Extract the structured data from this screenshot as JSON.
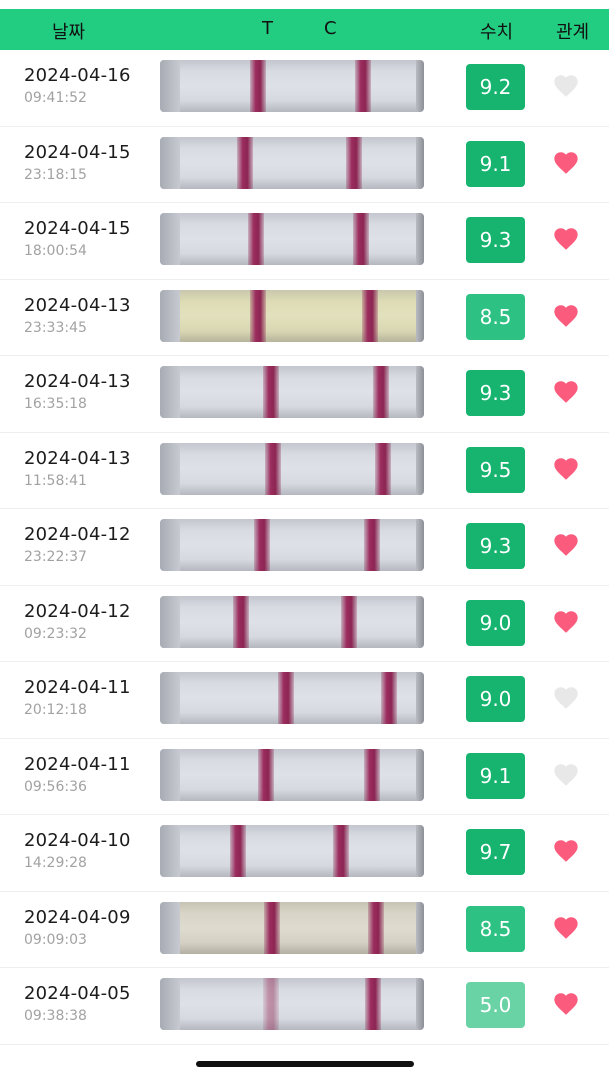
{
  "header": {
    "date_label": "날짜",
    "t_label": "T",
    "c_label": "C",
    "value_label": "수치",
    "relation_label": "관계"
  },
  "colors": {
    "header_bg": "#22cd82",
    "badge_strong": "#16b46f",
    "badge_mid": "#2dc283",
    "badge_light": "#6ad3a5",
    "heart_on": "#fb5b7d",
    "heart_off": "#e8e8e8"
  },
  "rows": [
    {
      "date": "2024-04-16",
      "time": "09:41:52",
      "value": "9.2",
      "heart": false,
      "tone": "strong",
      "strip_bg": "cool"
    },
    {
      "date": "2024-04-15",
      "time": "23:18:15",
      "value": "9.1",
      "heart": true,
      "tone": "strong",
      "strip_bg": "cool"
    },
    {
      "date": "2024-04-15",
      "time": "18:00:54",
      "value": "9.3",
      "heart": true,
      "tone": "strong",
      "strip_bg": "cool"
    },
    {
      "date": "2024-04-13",
      "time": "23:33:45",
      "value": "8.5",
      "heart": true,
      "tone": "mid",
      "strip_bg": "yellow"
    },
    {
      "date": "2024-04-13",
      "time": "16:35:18",
      "value": "9.3",
      "heart": true,
      "tone": "strong",
      "strip_bg": "cool"
    },
    {
      "date": "2024-04-13",
      "time": "11:58:41",
      "value": "9.5",
      "heart": true,
      "tone": "strong",
      "strip_bg": "cool"
    },
    {
      "date": "2024-04-12",
      "time": "23:22:37",
      "value": "9.3",
      "heart": true,
      "tone": "strong",
      "strip_bg": "cool"
    },
    {
      "date": "2024-04-12",
      "time": "09:23:32",
      "value": "9.0",
      "heart": true,
      "tone": "strong",
      "strip_bg": "cool"
    },
    {
      "date": "2024-04-11",
      "time": "20:12:18",
      "value": "9.0",
      "heart": false,
      "tone": "strong",
      "strip_bg": "cool"
    },
    {
      "date": "2024-04-11",
      "time": "09:56:36",
      "value": "9.1",
      "heart": false,
      "tone": "strong",
      "strip_bg": "cool"
    },
    {
      "date": "2024-04-10",
      "time": "14:29:28",
      "value": "9.7",
      "heart": true,
      "tone": "strong",
      "strip_bg": "cool"
    },
    {
      "date": "2024-04-09",
      "time": "09:09:03",
      "value": "8.5",
      "heart": true,
      "tone": "mid",
      "strip_bg": "warm"
    },
    {
      "date": "2024-04-05",
      "time": "09:38:38",
      "value": "5.0",
      "heart": true,
      "tone": "light",
      "strip_bg": "cool"
    }
  ]
}
